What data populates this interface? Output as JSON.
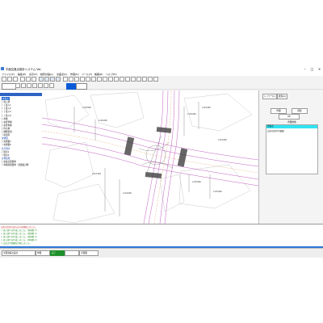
{
  "window": {
    "title": "平面交差点設計システム Ver.",
    "controls": [
      "–",
      "□",
      "×"
    ]
  },
  "menu": [
    "ファイル(F)",
    "編集(E)",
    "表示(V)",
    "線形計画(L)",
    "交差点(C)",
    "作図(D)",
    "ツール(T)",
    "帳票(R)",
    "ヘルプ(H)"
  ],
  "toolbar": {
    "field_value": "",
    "mode_label": "",
    "scale_label": ""
  },
  "tree": {
    "header": "",
    "items": [
      {
        "label": "交差点",
        "style": "selrow"
      },
      {
        "label": "├ 流入部",
        "style": ""
      },
      {
        "label": "│ ├ 流入1",
        "style": ""
      },
      {
        "label": "│ ├ 流入2",
        "style": ""
      },
      {
        "label": "│ ├ 流入3",
        "style": ""
      },
      {
        "label": "│ └ 流入4",
        "style": ""
      },
      {
        "label": "├ 車線",
        "style": ""
      },
      {
        "label": "├ 右折車線",
        "style": ""
      },
      {
        "label": "├ 左折車線",
        "style": ""
      },
      {
        "label": "├ 停止線",
        "style": ""
      },
      {
        "label": "├ 横断歩道",
        "style": ""
      },
      {
        "label": "└ 導流帯",
        "style": ""
      },
      {
        "label": "交通量",
        "style": "blue"
      },
      {
        "label": "├ 交通量1",
        "style": ""
      },
      {
        "label": "└ 交通量2",
        "style": ""
      },
      {
        "label": "信号現示",
        "style": "blue"
      },
      {
        "label": "├ 現示1",
        "style": ""
      },
      {
        "label": "└ 現示2",
        "style": ""
      },
      {
        "label": "計算結果",
        "style": "blue"
      },
      {
        "label": "├ 交差点需要率",
        "style": ""
      },
      {
        "label": "└ 車線別需要率・混雑度計算",
        "style": ""
      }
    ]
  },
  "drawing": {
    "dimension_labels": [
      "L=18.500",
      "L=20.000",
      "L=25.000",
      "L=25.000",
      "L=23.100",
      "L=24.000",
      "L=30.000",
      "L=22.000",
      "L=25.000"
    ]
  },
  "right_panel": {
    "tabs": [
      "レイヤー(L)",
      "属性(A)"
    ],
    "buttons": [
      "作図",
      "削除"
    ],
    "apply_button": "OK",
    "list_title": "作図対象",
    "list_items": [
      "交差点",
      "交差点形状(平面図)"
    ]
  },
  "log": {
    "lines": [
      "交差点形状の読み込みを開始しました。",
      "> 流入部1 を作成しました。(車線数 2)",
      "> 流入部2 を作成しました。(車線数 2)",
      "> 流入部3 を作成しました。(車線数 2)",
      "> 流入部4 を作成しました。(車線数 2)",
      "> 交差点平面図を作図しました。"
    ]
  },
  "status": {
    "items": [
      "平面交差点設計",
      "作図",
      "完了",
      "",
      "平面図"
    ]
  },
  "colors": {
    "road_outline": "#c060c0",
    "crosswalk": "#333333",
    "selection": "#1e66d0",
    "highlight": "#31e3f3",
    "log_green": "#228822",
    "log_red": "#cc2222",
    "status_green": "#1f8f2a"
  }
}
